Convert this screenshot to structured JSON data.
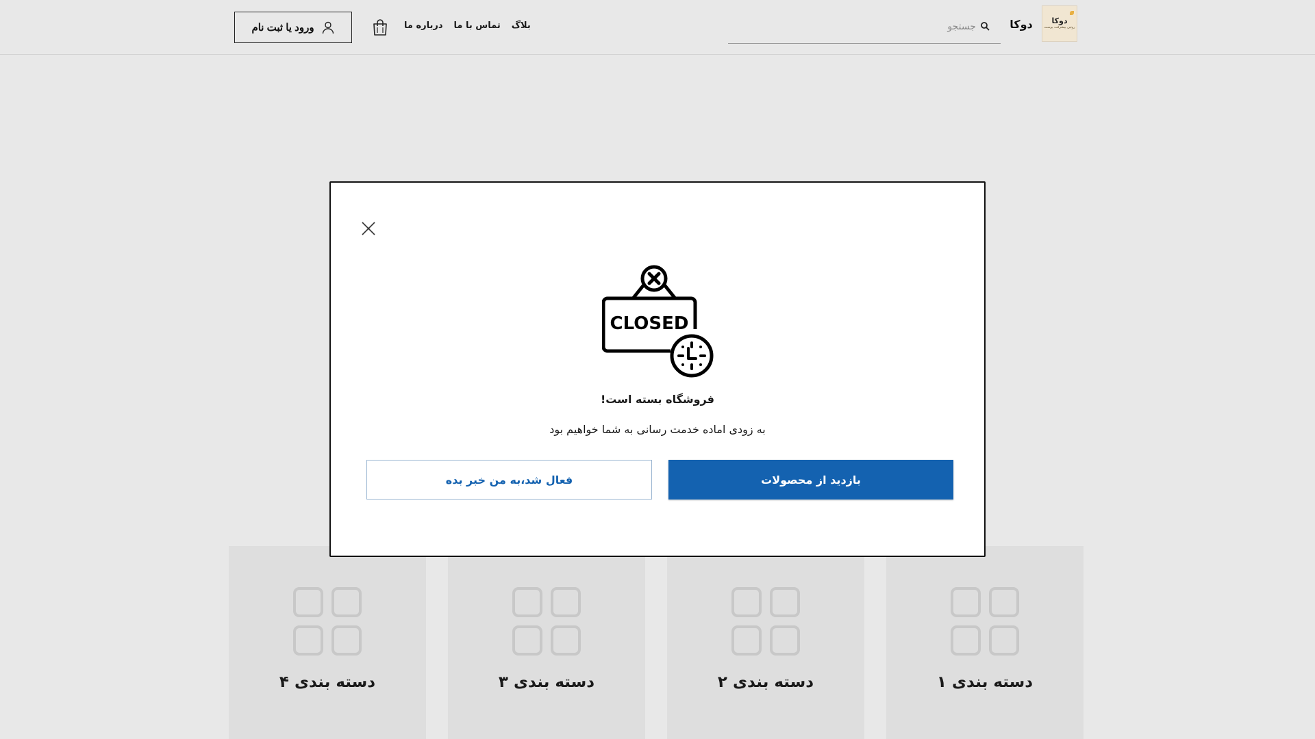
{
  "header": {
    "logo": {
      "name": "دوکا",
      "tagline": "روتین پیشرفت پوست"
    },
    "brand_name": "دوکا",
    "search": {
      "placeholder": "جستجو",
      "value": ""
    },
    "nav": [
      "درباره ما",
      "تماس با ما",
      "بلاگ"
    ],
    "login_label": "ورود یا ثبت نام",
    "icons": {
      "search": "search-icon",
      "cart": "shopping-bag-icon",
      "user": "user-icon"
    }
  },
  "categories": [
    {
      "label": "دسته بندی ۴",
      "icon": "grid-icon"
    },
    {
      "label": "دسته بندی ۳",
      "icon": "grid-icon"
    },
    {
      "label": "دسته بندی ۲",
      "icon": "grid-icon"
    },
    {
      "label": "دسته بندی ۱",
      "icon": "grid-icon"
    }
  ],
  "modal": {
    "image_text": "CLOSED",
    "title": "فروشگاه بسته است!",
    "message": "به زودی اماده خدمت رسانی به شما خواهیم بود",
    "primary_button": "بازدید از محصولات",
    "secondary_button": "فعال شد،به من خبر بده",
    "icons": {
      "close": "close-icon",
      "art": "closed-sign-clock-icon"
    }
  },
  "colors": {
    "background": "#e8e8e8",
    "primary": "#1462b0",
    "card": "#dedede",
    "card_icon": "#c8c8c8"
  }
}
